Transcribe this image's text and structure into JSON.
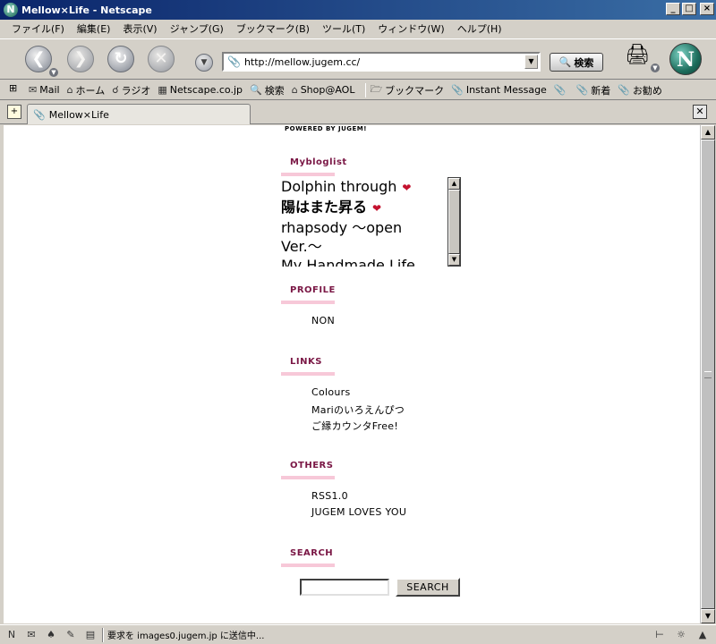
{
  "window": {
    "title": "Mellow×Life - Netscape",
    "minimize": "_",
    "maximize": "□",
    "close": "×"
  },
  "menu": [
    "ファイル(F)",
    "編集(E)",
    "表示(V)",
    "ジャンプ(G)",
    "ブックマーク(B)",
    "ツール(T)",
    "ウィンドウ(W)",
    "ヘルプ(H)"
  ],
  "nav": {
    "url": "http://mellow.jugem.cc/",
    "search_label": "検索"
  },
  "personal_toolbar": [
    {
      "icon": "mail-icon",
      "label": "Mail"
    },
    {
      "icon": "home-icon",
      "label": "ホーム"
    },
    {
      "icon": "radio-icon",
      "label": "ラジオ"
    },
    {
      "icon": "my-icon",
      "label": "Netscape.co.jp"
    },
    {
      "icon": "search-icon",
      "label": "検索"
    },
    {
      "icon": "shop-icon",
      "label": "Shop@AOL"
    },
    {
      "icon": "folder-icon",
      "label": "ブックマーク"
    },
    {
      "icon": "bookmark-icon",
      "label": "Instant Message"
    },
    {
      "icon": "bookmark-icon",
      "label": ""
    },
    {
      "icon": "bookmark-icon",
      "label": "新着"
    },
    {
      "icon": "bookmark-icon",
      "label": "お勧め"
    }
  ],
  "tab": {
    "label": "Mellow×Life"
  },
  "page": {
    "powered": "POWERED BY JUGEM!",
    "mybloglist": {
      "heading": "Mybloglist",
      "items": [
        "Dolphin through",
        "陽はまた昇る",
        "rhapsody 〜open Ver.〜",
        "My Handmade Life"
      ]
    },
    "profile": {
      "heading": "PROFILE",
      "items": [
        "NON"
      ]
    },
    "links": {
      "heading": "LINKS",
      "items": [
        "Colours",
        "Mariのいろえんぴつ",
        "ご縁カウンタFree!"
      ]
    },
    "others": {
      "heading": "OTHERS",
      "items": [
        "RSS1.0",
        "JUGEM LOVES YOU"
      ]
    },
    "search": {
      "heading": "SEARCH",
      "button": "SEARCH",
      "value": ""
    }
  },
  "status": {
    "text": "要求を images0.jugem.jp に送信中..."
  },
  "colors": {
    "heading": "#7a1745",
    "heart": "#c4122f",
    "underline": "#f7c8d8"
  }
}
